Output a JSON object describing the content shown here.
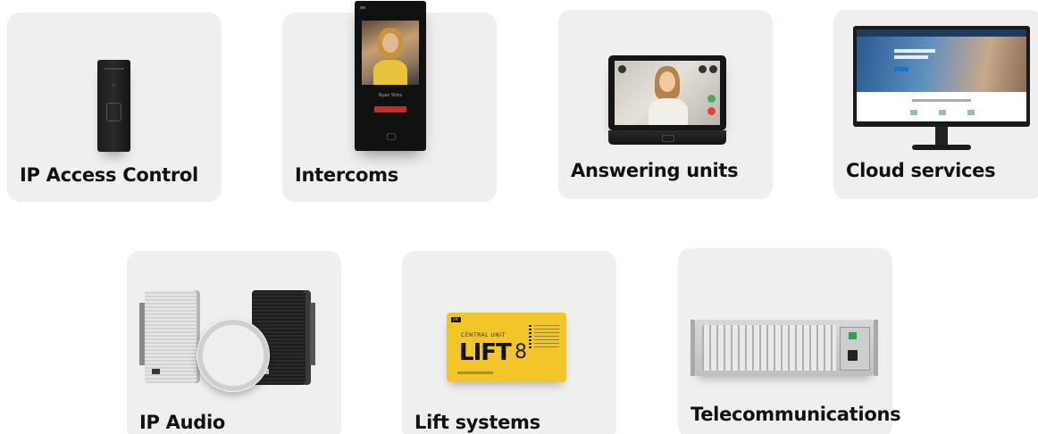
{
  "products": {
    "access_control": {
      "label": "IP Access Control"
    },
    "intercoms": {
      "label": "Intercoms",
      "screen_name": "Ryan Sims"
    },
    "answering_units": {
      "label": "Answering units"
    },
    "cloud_services": {
      "label": "Cloud services"
    },
    "ip_audio": {
      "label": "IP Audio"
    },
    "lift_systems": {
      "label": "Lift systems",
      "board_brand": "2N",
      "board_subtitle": "CENTRAL UNIT",
      "board_title": "LIFT",
      "board_number": "8"
    },
    "telecommunications": {
      "label": "Telecommunications"
    }
  },
  "colors": {
    "card_background": "#efefef",
    "label_text": "#111111",
    "lift_yellow": "#f2c628",
    "intercom_red": "#d2262a"
  },
  "icons": {
    "access_control": "access-reader-device-icon",
    "intercoms": "intercom-device-icon",
    "answering_units": "answering-unit-device-icon",
    "cloud_services": "monitor-icon",
    "ip_audio": "speakers-icon",
    "lift_systems": "lift-unit-icon",
    "telecommunications": "rack-gateway-icon"
  }
}
